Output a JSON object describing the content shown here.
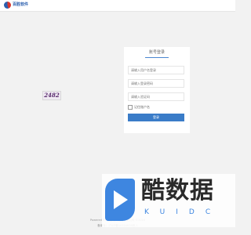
{
  "header": {
    "logo_text": "百胜软件"
  },
  "login": {
    "tab_label": "账号登录",
    "username_placeholder": "请输入用户名登录",
    "password_placeholder": "请输入登录密码",
    "captcha_placeholder": "请输入验证码",
    "captcha_text": "2482",
    "remember_label": "记住账户名",
    "submit_label": "登录"
  },
  "footer": {
    "line1": "Powered By 百胜软件股份有限公司 ©2016",
    "line2": "备案号：沪ICP备10304878号-1"
  },
  "ad": {
    "title": "酷数据",
    "letters": "KUIDC"
  },
  "colors": {
    "accent": "#3a7cc8",
    "background": "#f2f2f2",
    "ad_blue": "#3e86e0"
  }
}
